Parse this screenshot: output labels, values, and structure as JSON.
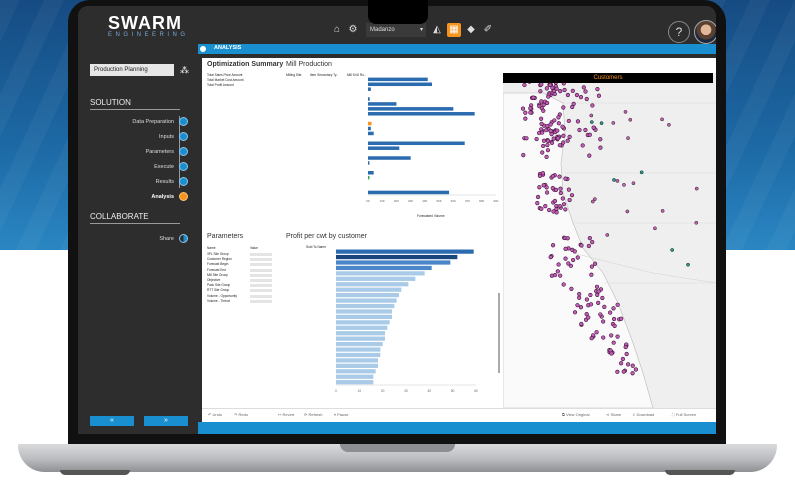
{
  "logo": {
    "main": "SWARM",
    "sub": "ENGINEERING"
  },
  "toolbar": {
    "model_select": "Madanzo",
    "help": "?"
  },
  "breadcrumb": {
    "label": "ANALYSIS"
  },
  "sidebar": {
    "project_select": "Production Planning",
    "solution_title": "SOLUTION",
    "solution_items": [
      {
        "label": "Data Preparation"
      },
      {
        "label": "Inputs"
      },
      {
        "label": "Parameters"
      },
      {
        "label": "Execute"
      },
      {
        "label": "Results"
      },
      {
        "label": "Analysis"
      }
    ],
    "collaborate_title": "COLLABORATE",
    "collaborate_items": [
      {
        "label": "Share"
      }
    ],
    "prev_label": "«",
    "next_label": "»"
  },
  "dashboard": {
    "optimization_title": "Optimization Summary",
    "summary_rows": [
      "Total Sales Price Amount",
      "Total Market Cost Amount",
      "Total Profit Amount"
    ],
    "mill_title": "Mill Production",
    "mill_headers": [
      "Milling Site",
      "Item Secondary Ty..",
      "Mill Sr/U Ro.."
    ],
    "mill_axis_label": "Forecasted Volume",
    "mill_ticks": [
      "0K",
      "10K",
      "20K",
      "30K",
      "40K",
      "50K",
      "60K",
      "70K",
      "80K",
      "90K"
    ],
    "parameters_title": "Parameters",
    "param_headers": [
      "Name",
      "Value"
    ],
    "param_names": [
      "3PL Site Group",
      "Customer Region",
      "Forecast Begin",
      "Forecast End",
      "Mill Site Group",
      "Objective",
      "Pack Site Group",
      "RTT Site Group",
      "Volume - Opportunity",
      "Volume - Threat"
    ],
    "profit_title": "Profit per cwt by customer",
    "profit_header": "Sold To Name",
    "profit_ticks": [
      "0",
      "10",
      "20",
      "30",
      "40",
      "50",
      "60"
    ],
    "customers_title": "Customers"
  },
  "bottombar": {
    "undo": "Undo",
    "redo": "Redo",
    "revert": "Revert",
    "refresh": "Refresh",
    "pause": "Pause",
    "view_original": "View Original",
    "share": "Share",
    "download": "Download",
    "full_screen": "Full Screen"
  },
  "colors": {
    "accent_blue": "#1a8fd0",
    "accent_orange": "#f7941e",
    "bar_dark": "#2b6cb0",
    "bar_light": "#a9cbe8"
  },
  "chart_data": [
    {
      "type": "bar",
      "title": "Mill Production",
      "xlabel": "Forecasted Volume",
      "xlim": [
        0,
        90000
      ],
      "series": [
        {
          "values": [
            42000,
            45000,
            2000,
            0,
            1200,
            20000,
            60000,
            75000,
            0,
            2500,
            2000,
            4000,
            0,
            68000,
            22000,
            0,
            30000,
            1000,
            0,
            4000,
            1000,
            0,
            0,
            57000
          ]
        }
      ]
    },
    {
      "type": "bar",
      "title": "Profit per cwt by customer",
      "xlim": [
        0,
        60
      ],
      "values": [
        59,
        52,
        49,
        41,
        38,
        34,
        31,
        28,
        27,
        26,
        25,
        24,
        24,
        23,
        22,
        21,
        21,
        20,
        19,
        19,
        18,
        18,
        17,
        16,
        16
      ]
    }
  ]
}
